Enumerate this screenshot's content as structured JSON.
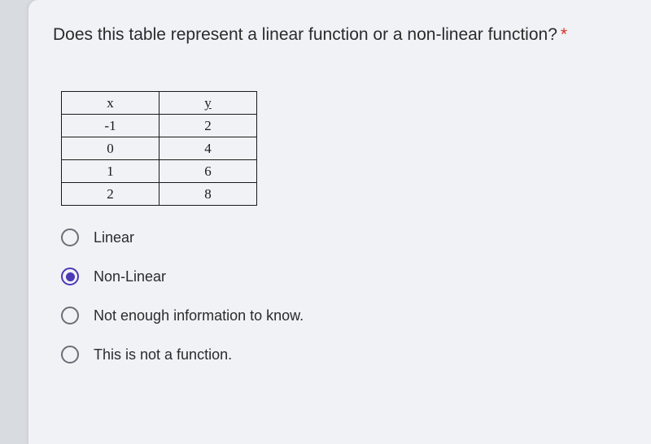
{
  "question": {
    "text": "Does this table represent a linear function or a non-linear function?",
    "required_marker": "*"
  },
  "table": {
    "headers": {
      "x": "x",
      "y": "y"
    },
    "rows": [
      {
        "x": "-1",
        "y": "2"
      },
      {
        "x": "0",
        "y": "4"
      },
      {
        "x": "1",
        "y": "6"
      },
      {
        "x": "2",
        "y": "8"
      }
    ]
  },
  "options": [
    {
      "label": "Linear",
      "selected": false
    },
    {
      "label": "Non-Linear",
      "selected": true
    },
    {
      "label": "Not enough information to know.",
      "selected": false
    },
    {
      "label": "This is not a function.",
      "selected": false
    }
  ]
}
